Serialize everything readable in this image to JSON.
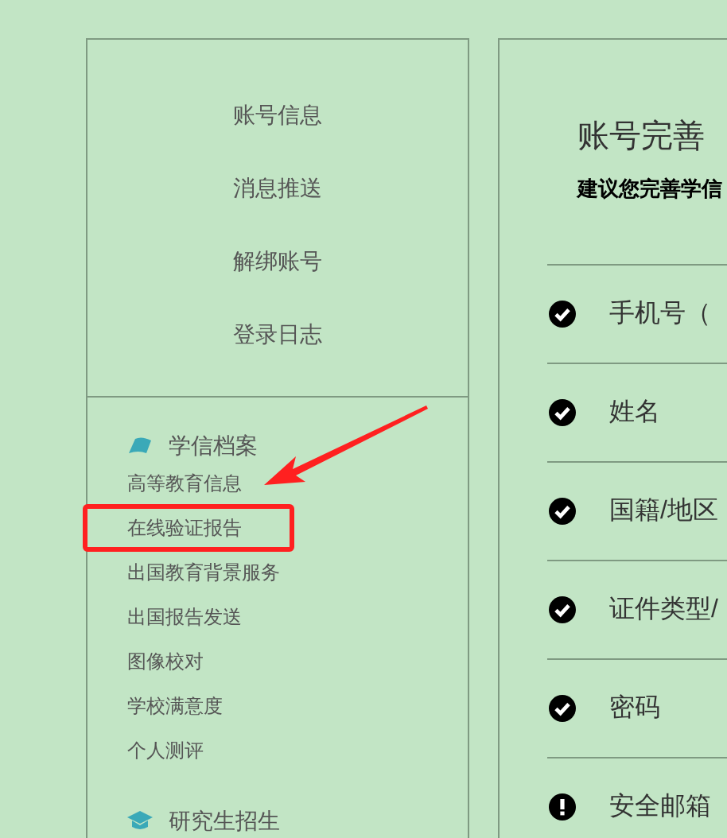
{
  "account_menu": [
    "账号信息",
    "消息推送",
    "解绑账号",
    "登录日志"
  ],
  "sections": [
    {
      "title": "学信档案",
      "kind": "book",
      "items": [
        {
          "label": "高等教育信息",
          "highlighted": false
        },
        {
          "label": "在线验证报告",
          "highlighted": true
        },
        {
          "label": "出国教育背景服务",
          "highlighted": false
        },
        {
          "label": "出国报告发送",
          "highlighted": false
        },
        {
          "label": "图像校对",
          "highlighted": false
        },
        {
          "label": "学校满意度",
          "highlighted": false
        },
        {
          "label": "个人测评",
          "highlighted": false
        }
      ]
    },
    {
      "title": "研究生招生",
      "kind": "cap"
    }
  ],
  "completeness": {
    "title": "账号完善",
    "subtitle": "建议您完善学信",
    "rows": [
      {
        "label": "手机号（",
        "complete": true
      },
      {
        "label": "姓名",
        "complete": true
      },
      {
        "label": "国籍/地区",
        "complete": true
      },
      {
        "label": "证件类型/",
        "complete": true
      },
      {
        "label": "密码",
        "complete": true
      },
      {
        "label": "安全邮箱",
        "complete": false
      }
    ]
  }
}
